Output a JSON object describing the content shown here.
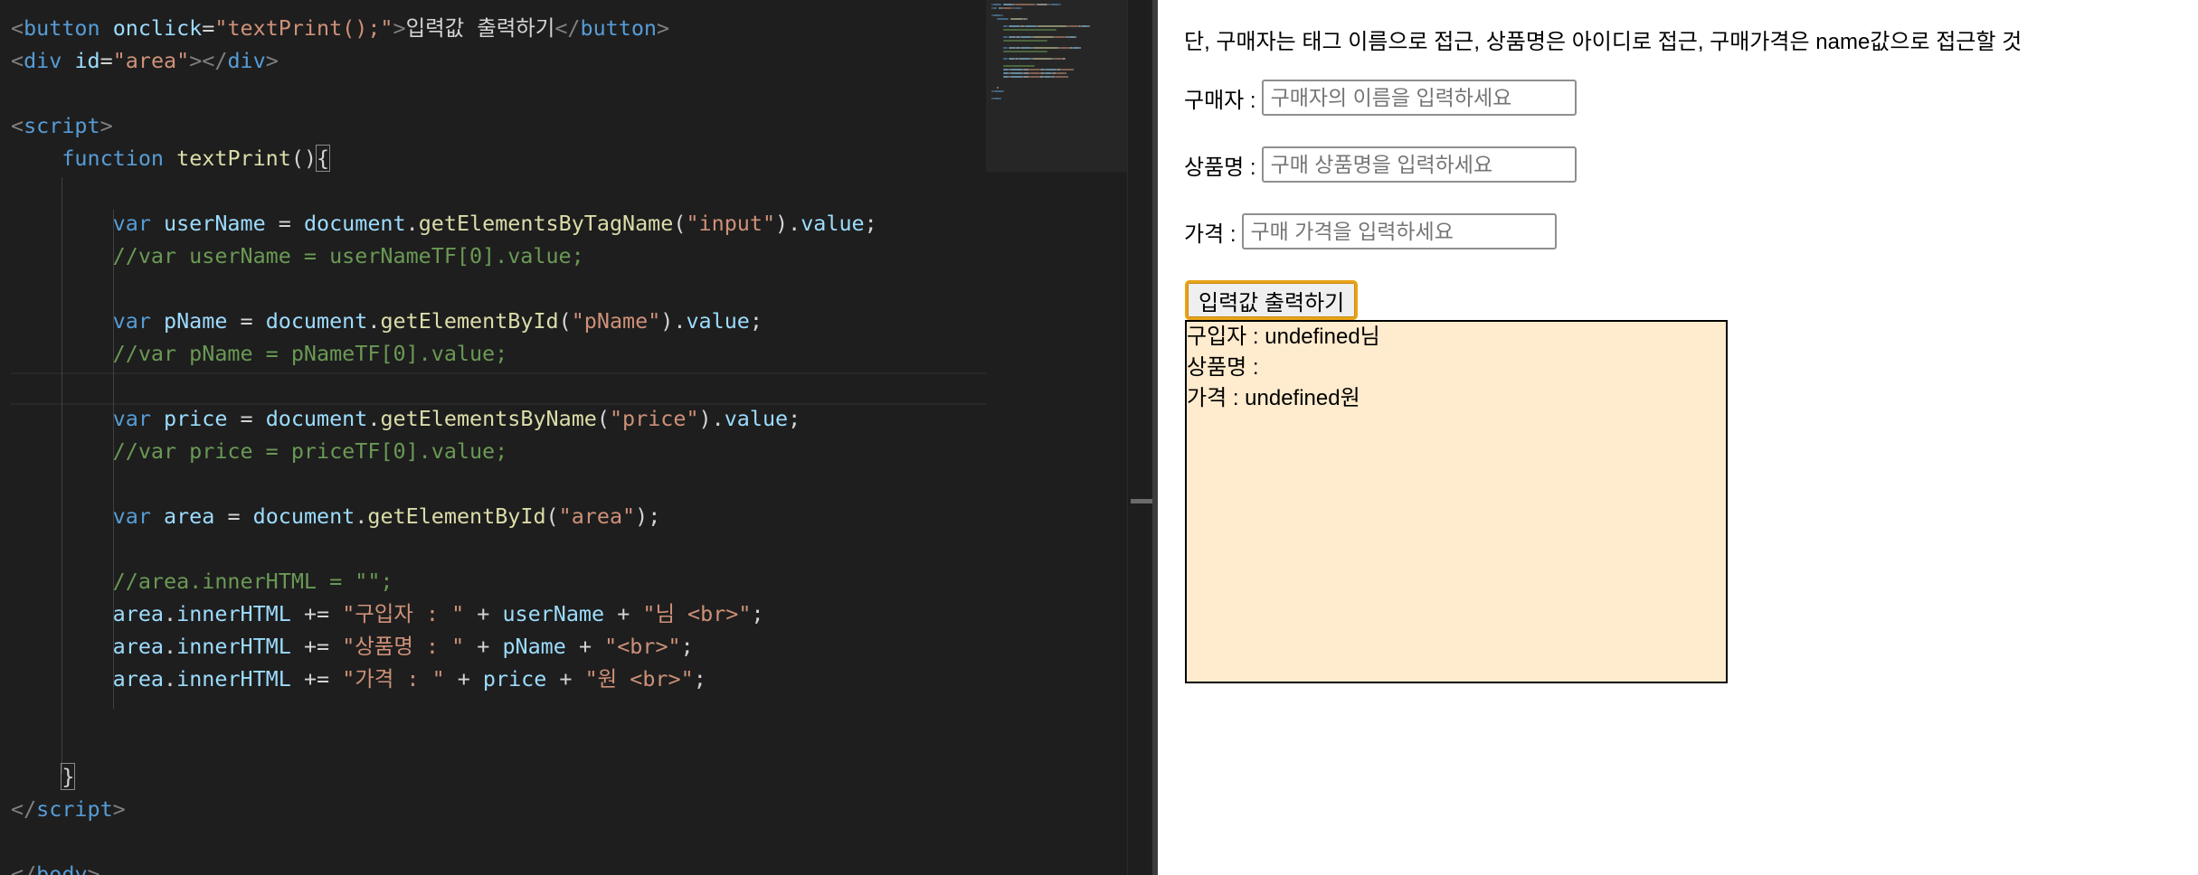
{
  "editor": {
    "lines": [
      [
        [
          "t-tag",
          "<"
        ],
        [
          "t-tname",
          "button"
        ],
        [
          "t-txt",
          " "
        ],
        [
          "t-attr",
          "onclick"
        ],
        [
          "t-op",
          "="
        ],
        [
          "t-str",
          "\"textPrint();\""
        ],
        [
          "t-tag",
          ">"
        ],
        [
          "t-txt",
          "입력값 출력하기"
        ],
        [
          "t-tag",
          "</"
        ],
        [
          "t-tname",
          "button"
        ],
        [
          "t-tag",
          ">"
        ]
      ],
      [
        [
          "t-tag",
          "<"
        ],
        [
          "t-tname",
          "div"
        ],
        [
          "t-txt",
          " "
        ],
        [
          "t-attr",
          "id"
        ],
        [
          "t-op",
          "="
        ],
        [
          "t-str",
          "\"area\""
        ],
        [
          "t-tag",
          "></"
        ],
        [
          "t-tname",
          "div"
        ],
        [
          "t-tag",
          ">"
        ]
      ],
      [],
      [
        [
          "t-tag",
          "<"
        ],
        [
          "t-tname",
          "script"
        ],
        [
          "t-tag",
          ">"
        ]
      ],
      [
        [
          "t-txt",
          "    "
        ],
        [
          "t-kw",
          "function"
        ],
        [
          "t-txt",
          " "
        ],
        [
          "t-fn",
          "textPrint"
        ],
        [
          "t-op",
          "()"
        ],
        [
          "t-brace",
          "{"
        ]
      ],
      [],
      [
        [
          "t-txt",
          "        "
        ],
        [
          "t-kw",
          "var"
        ],
        [
          "t-txt",
          " "
        ],
        [
          "t-var",
          "userName"
        ],
        [
          "t-op",
          " = "
        ],
        [
          "t-var",
          "document"
        ],
        [
          "t-op",
          "."
        ],
        [
          "t-fn",
          "getElementsByTagName"
        ],
        [
          "t-op",
          "("
        ],
        [
          "t-str",
          "\"input\""
        ],
        [
          "t-op",
          ")."
        ],
        [
          "t-var",
          "value"
        ],
        [
          "t-op",
          ";"
        ]
      ],
      [
        [
          "t-txt",
          "        "
        ],
        [
          "t-com",
          "//var userName = userNameTF[0].value;"
        ]
      ],
      [],
      [
        [
          "t-txt",
          "        "
        ],
        [
          "t-kw",
          "var"
        ],
        [
          "t-txt",
          " "
        ],
        [
          "t-var",
          "pName"
        ],
        [
          "t-op",
          " = "
        ],
        [
          "t-var",
          "document"
        ],
        [
          "t-op",
          "."
        ],
        [
          "t-fn",
          "getElementById"
        ],
        [
          "t-op",
          "("
        ],
        [
          "t-str",
          "\"pName\""
        ],
        [
          "t-op",
          ")."
        ],
        [
          "t-var",
          "value"
        ],
        [
          "t-op",
          ";"
        ]
      ],
      [
        [
          "t-txt",
          "        "
        ],
        [
          "t-com",
          "//var pName = pNameTF[0].value;"
        ]
      ],
      [],
      [
        [
          "t-txt",
          "        "
        ],
        [
          "t-kw",
          "var"
        ],
        [
          "t-txt",
          " "
        ],
        [
          "t-var",
          "price"
        ],
        [
          "t-op",
          " = "
        ],
        [
          "t-var",
          "document"
        ],
        [
          "t-op",
          "."
        ],
        [
          "t-fn",
          "getElementsByName"
        ],
        [
          "t-op",
          "("
        ],
        [
          "t-str",
          "\"price\""
        ],
        [
          "t-op",
          ")."
        ],
        [
          "t-var",
          "value"
        ],
        [
          "t-op",
          ";"
        ]
      ],
      [
        [
          "t-txt",
          "        "
        ],
        [
          "t-com",
          "//var price = priceTF[0].value;"
        ]
      ],
      [],
      [
        [
          "t-txt",
          "        "
        ],
        [
          "t-kw",
          "var"
        ],
        [
          "t-txt",
          " "
        ],
        [
          "t-var",
          "area"
        ],
        [
          "t-op",
          " = "
        ],
        [
          "t-var",
          "document"
        ],
        [
          "t-op",
          "."
        ],
        [
          "t-fn",
          "getElementById"
        ],
        [
          "t-op",
          "("
        ],
        [
          "t-str",
          "\"area\""
        ],
        [
          "t-op",
          ");"
        ]
      ],
      [],
      [
        [
          "t-txt",
          "        "
        ],
        [
          "t-com",
          "//area.innerHTML = \"\";"
        ]
      ],
      [
        [
          "t-txt",
          "        "
        ],
        [
          "t-var",
          "area"
        ],
        [
          "t-op",
          "."
        ],
        [
          "t-var",
          "innerHTML"
        ],
        [
          "t-op",
          " += "
        ],
        [
          "t-str",
          "\"구입자 : \""
        ],
        [
          "t-op",
          " + "
        ],
        [
          "t-var",
          "userName"
        ],
        [
          "t-op",
          " + "
        ],
        [
          "t-str",
          "\"님 <br>\""
        ],
        [
          "t-op",
          ";"
        ]
      ],
      [
        [
          "t-txt",
          "        "
        ],
        [
          "t-var",
          "area"
        ],
        [
          "t-op",
          "."
        ],
        [
          "t-var",
          "innerHTML"
        ],
        [
          "t-op",
          " += "
        ],
        [
          "t-str",
          "\"상품명 : \""
        ],
        [
          "t-op",
          " + "
        ],
        [
          "t-var",
          "pName"
        ],
        [
          "t-op",
          " + "
        ],
        [
          "t-str",
          "\"<br>\""
        ],
        [
          "t-op",
          ";"
        ]
      ],
      [
        [
          "t-txt",
          "        "
        ],
        [
          "t-var",
          "area"
        ],
        [
          "t-op",
          "."
        ],
        [
          "t-var",
          "innerHTML"
        ],
        [
          "t-op",
          " += "
        ],
        [
          "t-str",
          "\"가격 : \""
        ],
        [
          "t-op",
          " + "
        ],
        [
          "t-var",
          "price"
        ],
        [
          "t-op",
          " + "
        ],
        [
          "t-str",
          "\"원 <br>\""
        ],
        [
          "t-op",
          ";"
        ]
      ],
      [],
      [],
      [
        [
          "t-txt",
          "    "
        ],
        [
          "t-brace",
          "}"
        ]
      ],
      [
        [
          "t-tag",
          "</"
        ],
        [
          "t-tname",
          "script"
        ],
        [
          "t-tag",
          ">"
        ]
      ],
      [],
      [
        [
          "t-tag",
          "</"
        ],
        [
          "t-tname",
          "body"
        ],
        [
          "t-tag",
          ">"
        ]
      ]
    ]
  },
  "preview": {
    "instruction": "단, 구매자는 태그 이름으로 접근, 상품명은 아이디로 접근, 구매가격은 name값으로 접근할 것",
    "buyer_label": "구매자 :",
    "buyer_placeholder": "구매자의 이름을 입력하세요",
    "product_label": "상품명 :",
    "product_placeholder": "구매 상품명을 입력하세요",
    "price_label": "가격 :",
    "price_placeholder": "구매 가격을 입력하세요",
    "print_button_label": "입력값 출력하기",
    "area_lines": [
      "구입자 : undefined님",
      "상품명 :",
      "가격 : undefined원"
    ]
  },
  "colors": {
    "editor_bg": "#1e1e1e",
    "area_bg": "#ffebcd",
    "button_focus": "#e8a317"
  }
}
